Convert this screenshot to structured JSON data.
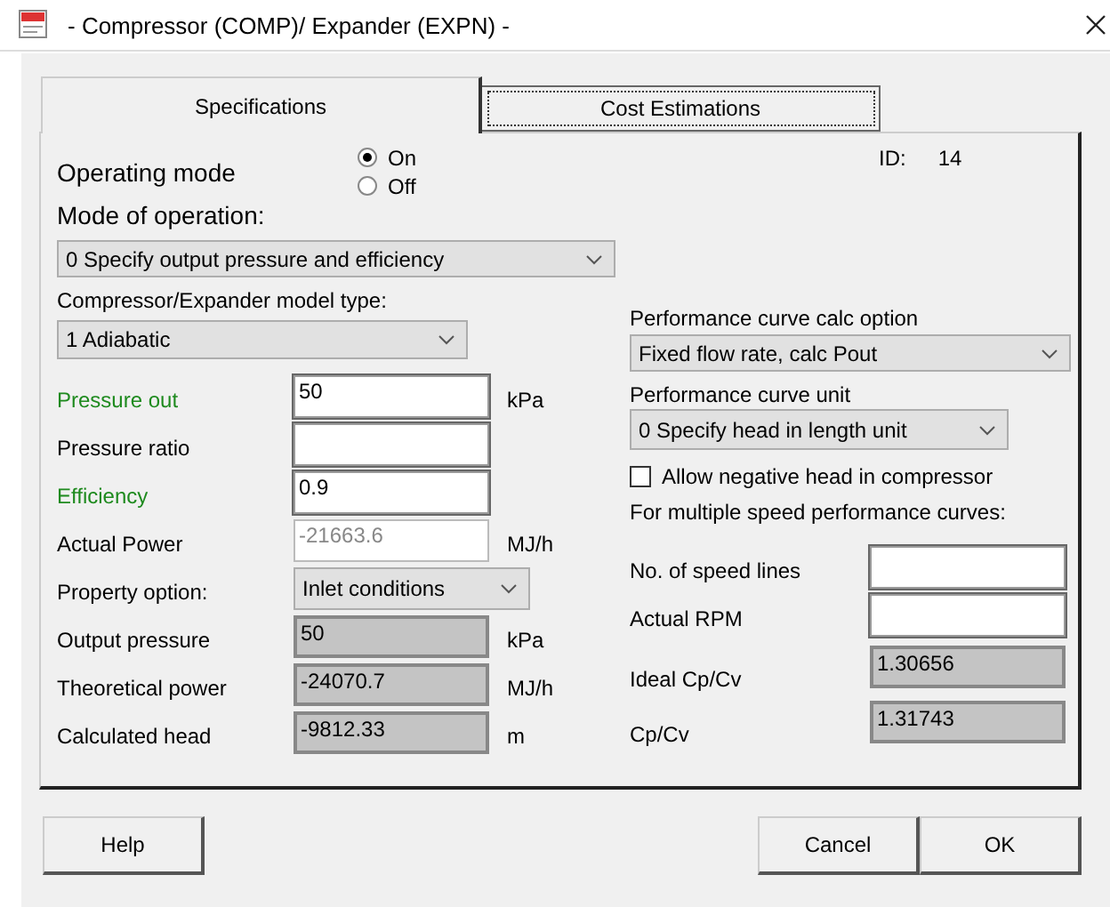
{
  "window": {
    "title": "- Compressor (COMP)/ Expander (EXPN) -"
  },
  "tabs": [
    {
      "label": "Specifications",
      "selected": true
    },
    {
      "label": "Cost Estimations",
      "selected": false
    }
  ],
  "operating_mode": {
    "label": "Operating mode",
    "options": [
      {
        "label": "On",
        "selected": true
      },
      {
        "label": "Off",
        "selected": false
      }
    ]
  },
  "id": {
    "label": "ID:",
    "value": "14"
  },
  "mode_of_operation": {
    "label": "Mode of operation:",
    "value": "0 Specify output pressure and efficiency"
  },
  "model_type": {
    "label": "Compressor/Expander model type:",
    "value": "1 Adiabatic"
  },
  "left_fields": [
    {
      "label": "Pressure out",
      "required": true,
      "kind": "input",
      "value": "50",
      "unit": "kPa"
    },
    {
      "label": "Pressure ratio",
      "required": false,
      "kind": "input"
    },
    {
      "label": "Efficiency",
      "required": true,
      "kind": "input",
      "value": "0.9"
    },
    {
      "label": "Actual Power",
      "required": false,
      "kind": "readonly",
      "value": "-21663.6",
      "unit": "MJ/h"
    },
    {
      "label": "Property option:",
      "required": false,
      "kind": "select",
      "value": "Inlet conditions"
    },
    {
      "label": "Output pressure",
      "required": false,
      "kind": "output",
      "value": "50",
      "unit": "kPa"
    },
    {
      "label": "Theoretical power",
      "required": false,
      "kind": "output",
      "value": "-24070.7",
      "unit": "MJ/h"
    },
    {
      "label": "Calculated head",
      "required": false,
      "kind": "output",
      "value": "-9812.33",
      "unit": "m"
    }
  ],
  "curve_calc_option": {
    "label": "Performance curve calc option",
    "value": "Fixed flow rate, calc Pout"
  },
  "curve_unit": {
    "label": "Performance curve unit",
    "value": "0  Specify head in length unit"
  },
  "allow_negative_head": {
    "label": "Allow negative head in compressor",
    "checked": false
  },
  "speed_note": "For multiple speed performance curves:",
  "right_fields": [
    {
      "label": "No. of speed lines",
      "kind": "input"
    },
    {
      "label": "Actual RPM",
      "kind": "input"
    },
    {
      "label": "Ideal Cp/Cv",
      "kind": "output",
      "value": "1.30656"
    },
    {
      "label": "Cp/Cv",
      "kind": "output",
      "value": "1.31743"
    }
  ],
  "buttons": [
    "Help",
    "Cancel",
    "OK"
  ]
}
